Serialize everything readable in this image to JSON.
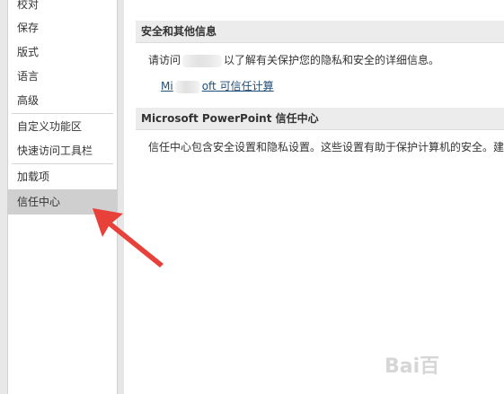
{
  "sidebar": {
    "items": [
      {
        "label": "校对"
      },
      {
        "label": "保存"
      },
      {
        "label": "版式"
      },
      {
        "label": "语言"
      },
      {
        "label": "高级"
      },
      {
        "label": "自定义功能区"
      },
      {
        "label": "快速访问工具栏"
      },
      {
        "label": "加载项"
      },
      {
        "label": "信任中心"
      }
    ],
    "selected": "信任中心"
  },
  "main": {
    "security_section": {
      "title": "安全和其他信息",
      "description_prefix": "请访问",
      "description_suffix": "以了解有关保护您的隐私和安全的详细信息。",
      "link_prefix": "Mi",
      "link_suffix": "oft 可信任计算"
    },
    "trust_center_section": {
      "title": "Microsoft PowerPoint 信任中心",
      "description": "信任中心包含安全设置和隐私设置。这些设置有助于保护计算机的安全。建"
    }
  },
  "annotation": {
    "arrow_color": "#e8413a"
  },
  "watermark": {
    "text": "Bai百"
  }
}
